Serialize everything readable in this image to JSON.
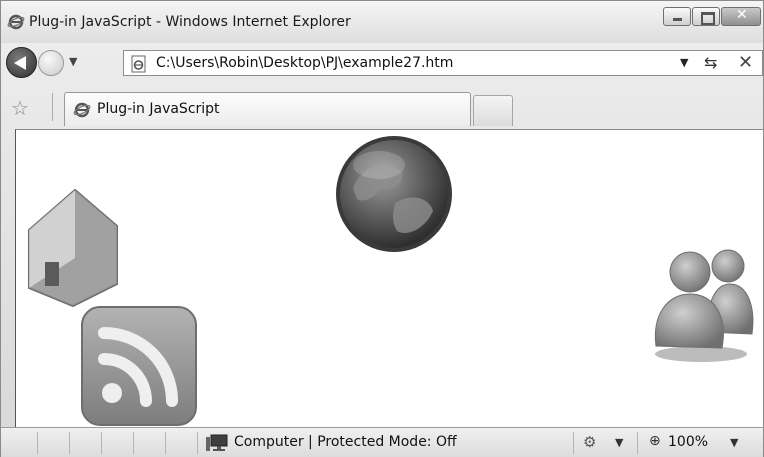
{
  "window": {
    "title": "Plug-in JavaScript - Windows Internet Explorer"
  },
  "navigation": {
    "address": "C:\\Users\\Robin\\Desktop\\PJ\\example27.htm"
  },
  "tabs": [
    {
      "label": "Plug-in JavaScript"
    }
  ],
  "content": {
    "images": [
      {
        "name": "globe",
        "icon": "globe-icon"
      },
      {
        "name": "house",
        "icon": "house-icon"
      },
      {
        "name": "rss",
        "icon": "rss-icon"
      },
      {
        "name": "users",
        "icon": "users-icon"
      }
    ]
  },
  "statusbar": {
    "zone_text": "Computer | Protected Mode: Off",
    "zoom": "100%"
  },
  "colors": {
    "content_background": "#ffffff",
    "chrome_background": "#d9d9d9"
  }
}
